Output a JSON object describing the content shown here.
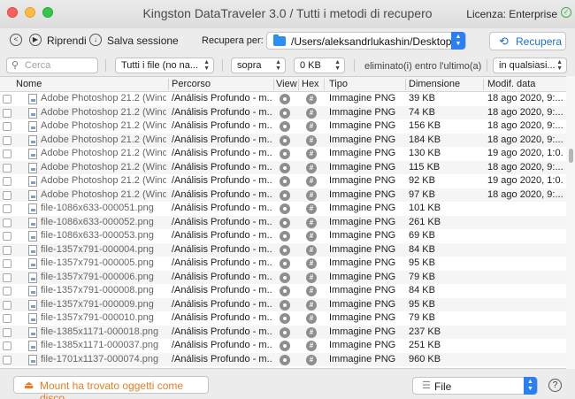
{
  "window": {
    "title": "Kingston DataTraveler 3.0 / Tutti i metodi di recupero",
    "license": "Licenza: Enterprise"
  },
  "toolbar": {
    "resume_label": "Riprendi",
    "save_label": "Salva sessione",
    "recover_to_label": "Recupera per:",
    "path_value": "/Users/aleksandrlukashin/Desktop",
    "recover_button": "Recupera"
  },
  "filters": {
    "search_placeholder": "Cerca",
    "file_type": "Tutti i file (no na...",
    "size_op": "sopra",
    "size_value": "0 KB",
    "deleted_label": "eliminato(i) entro l'ultimo(a)",
    "time_value": "in qualsiasi..."
  },
  "table": {
    "columns": [
      "Nome",
      "Percorso",
      "View",
      "Hex",
      "Tipo",
      "Dimensione",
      "Modif. data"
    ],
    "rows": [
      {
        "name": "Adobe Photoshop 21.2 (Wind...",
        "path": "/Análisis Profundo - m...",
        "type": "Immagine PNG",
        "size": "39 KB",
        "date": "18 ago 2020, 9:..."
      },
      {
        "name": "Adobe Photoshop 21.2 (Wind...",
        "path": "/Análisis Profundo - m...",
        "type": "Immagine PNG",
        "size": "74 KB",
        "date": "18 ago 2020, 9:..."
      },
      {
        "name": "Adobe Photoshop 21.2 (Wind...",
        "path": "/Análisis Profundo - m...",
        "type": "Immagine PNG",
        "size": "156 KB",
        "date": "18 ago 2020, 9:..."
      },
      {
        "name": "Adobe Photoshop 21.2 (Wind...",
        "path": "/Análisis Profundo - m...",
        "type": "Immagine PNG",
        "size": "184 KB",
        "date": "18 ago 2020, 9:..."
      },
      {
        "name": "Adobe Photoshop 21.2 (Wind...",
        "path": "/Análisis Profundo - m...",
        "type": "Immagine PNG",
        "size": "130 KB",
        "date": "19 ago 2020, 1:0..."
      },
      {
        "name": "Adobe Photoshop 21.2 (Wind...",
        "path": "/Análisis Profundo - m...",
        "type": "Immagine PNG",
        "size": "115 KB",
        "date": "18 ago 2020, 9:..."
      },
      {
        "name": "Adobe Photoshop 21.2 (Wind...",
        "path": "/Análisis Profundo - m...",
        "type": "Immagine PNG",
        "size": "92 KB",
        "date": "19 ago 2020, 1:0..."
      },
      {
        "name": "Adobe Photoshop 21.2 (Wind...",
        "path": "/Análisis Profundo - m...",
        "type": "Immagine PNG",
        "size": "97 KB",
        "date": "18 ago 2020, 9:..."
      },
      {
        "name": "file-1086x633-000051.png",
        "path": "/Análisis Profundo - m...",
        "type": "Immagine PNG",
        "size": "101 KB",
        "date": ""
      },
      {
        "name": "file-1086x633-000052.png",
        "path": "/Análisis Profundo - m...",
        "type": "Immagine PNG",
        "size": "261 KB",
        "date": ""
      },
      {
        "name": "file-1086x633-000053.png",
        "path": "/Análisis Profundo - m...",
        "type": "Immagine PNG",
        "size": "69 KB",
        "date": ""
      },
      {
        "name": "file-1357x791-000004.png",
        "path": "/Análisis Profundo - m...",
        "type": "Immagine PNG",
        "size": "84 KB",
        "date": ""
      },
      {
        "name": "file-1357x791-000005.png",
        "path": "/Análisis Profundo - m...",
        "type": "Immagine PNG",
        "size": "95 KB",
        "date": ""
      },
      {
        "name": "file-1357x791-000006.png",
        "path": "/Análisis Profundo - m...",
        "type": "Immagine PNG",
        "size": "79 KB",
        "date": ""
      },
      {
        "name": "file-1357x791-000008.png",
        "path": "/Análisis Profundo - m...",
        "type": "Immagine PNG",
        "size": "84 KB",
        "date": ""
      },
      {
        "name": "file-1357x791-000009.png",
        "path": "/Análisis Profundo - m...",
        "type": "Immagine PNG",
        "size": "95 KB",
        "date": ""
      },
      {
        "name": "file-1357x791-000010.png",
        "path": "/Análisis Profundo - m...",
        "type": "Immagine PNG",
        "size": "79 KB",
        "date": ""
      },
      {
        "name": "file-1385x1171-000018.png",
        "path": "/Análisis Profundo - m...",
        "type": "Immagine PNG",
        "size": "237 KB",
        "date": ""
      },
      {
        "name": "file-1385x1171-000037.png",
        "path": "/Análisis Profundo - m...",
        "type": "Immagine PNG",
        "size": "251 KB",
        "date": ""
      },
      {
        "name": "file-1701x1137-000074.png",
        "path": "/Análisis Profundo - m...",
        "type": "Immagine PNG",
        "size": "960 KB",
        "date": ""
      },
      {
        "name": "",
        "path": "",
        "type": "",
        "size": "",
        "date": ""
      }
    ]
  },
  "bottom": {
    "mount_button": "Mount ha trovato oggetti come disco",
    "view_mode": "File",
    "help": "?"
  },
  "colors": {
    "accent": "#2a7ff5",
    "mount_orange": "#e67e22",
    "license_check": "#3cb043"
  }
}
